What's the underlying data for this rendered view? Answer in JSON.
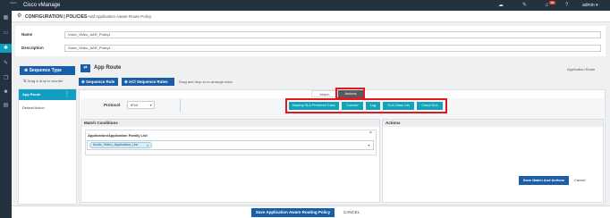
{
  "topbar": {
    "brand": "cisco",
    "app_name": "Cisco vManage",
    "icons": [
      "cloud-icon",
      "wrench-icon",
      "bell-icon",
      "help-icon"
    ],
    "notification_count": "45",
    "user": "admin",
    "user_caret": "▾"
  },
  "rail": {
    "items": [
      {
        "icon": "grid-icon",
        "glyph": "▦"
      },
      {
        "icon": "monitor-icon",
        "glyph": "▭"
      },
      {
        "icon": "gear-icon",
        "glyph": "✱"
      },
      {
        "icon": "tools-icon",
        "glyph": "✎"
      },
      {
        "icon": "copy-icon",
        "glyph": "❐"
      },
      {
        "icon": "users-icon",
        "glyph": "☻"
      },
      {
        "icon": "analytics-icon",
        "glyph": "▤"
      }
    ],
    "active_index": 2
  },
  "header": {
    "gear_glyph": "⚙",
    "section": "CONFIGURATION | POLICIES",
    "subtitle": "Add Application Aware Route Policy"
  },
  "form": {
    "name_label": "Name",
    "name_value": "Voice_Video_AAR_Policy1",
    "description_label": "Description",
    "description_value": "Voice_Video_AAR_Policy1"
  },
  "left_panel": {
    "sequence_type_button": "Sequence Type",
    "drag_note": "Drag & drop to reorder",
    "items": [
      {
        "label": "App Route",
        "selected": true
      },
      {
        "label": "Default Action",
        "selected": false
      }
    ]
  },
  "route": {
    "icon_glyph": "⇄",
    "title": "App Route",
    "right_label": "Application Route",
    "sequence_rule_button": "Sequence Rule",
    "acl_sequence_rules_button": "ACl Sequence Rules",
    "drag_note": "Drag and drop to re-arrange rules",
    "tabs": {
      "match": "Match",
      "actions": "Actions"
    },
    "protocol_label": "Protocol",
    "protocol_value": "IPv4",
    "action_buttons": [
      "Backup SLA Preferred Color",
      "Counter",
      "Log",
      "SLA Class List",
      "Cloud SLA"
    ],
    "match_conditions_title": "Match Conditions",
    "actions_title": "Actions",
    "family_list_label": "Application/Application Family List",
    "family_list_chip": "Audio_Video_Application_List",
    "save_match_button": "Save Match And Actions",
    "cancel_label": "Cancel"
  },
  "footer": {
    "save_policy_button": "Save Application Aware Routing Policy",
    "cancel_label": "CANCEL"
  }
}
